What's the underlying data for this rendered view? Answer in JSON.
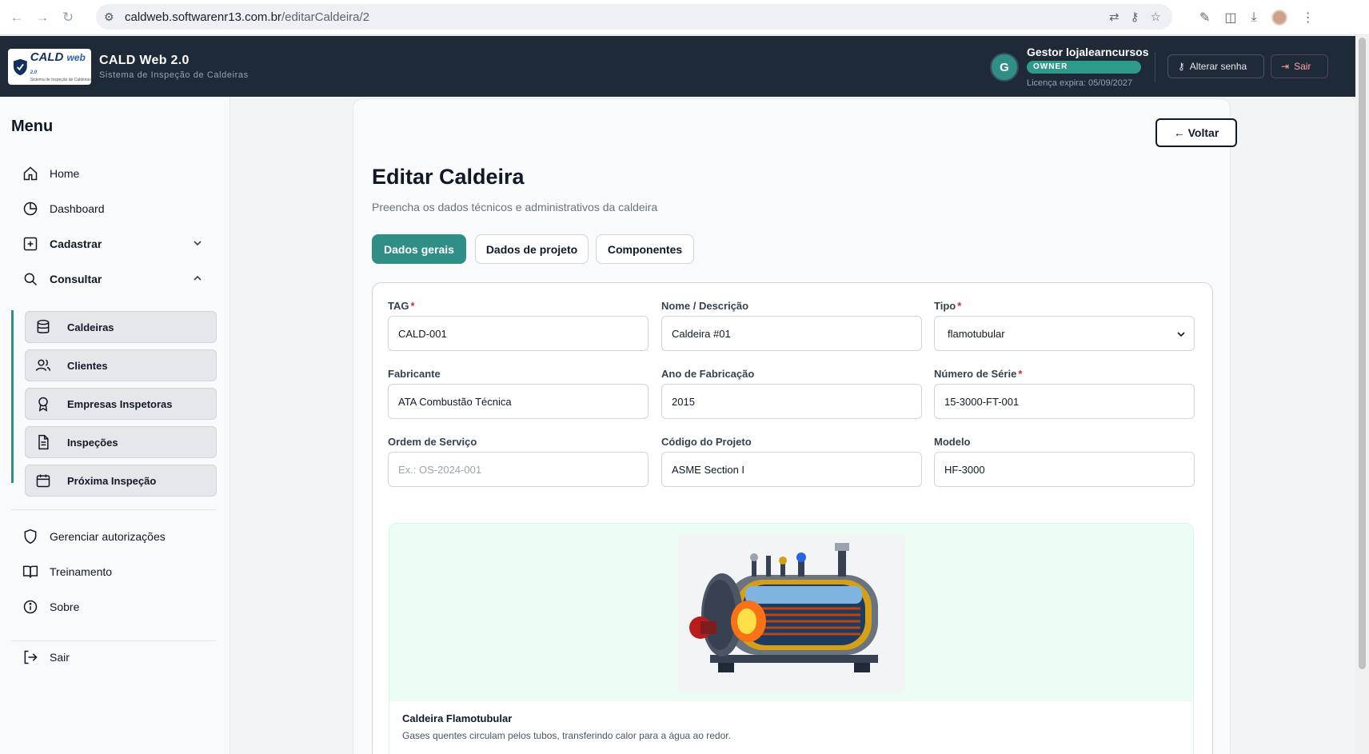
{
  "browser": {
    "url_domain": "caldweb.softwarenr13.com.br",
    "url_path": "/editarCaldeira/2"
  },
  "header": {
    "app_title": "CALD Web 2.0",
    "app_subtitle": "Sistema de Inspeção de Caldeiras",
    "logo_text": "CALD",
    "logo_web": "web",
    "logo_version": "2.0",
    "logo_tagline": "Sistema de Inspeção de Caldeiras",
    "user_initial": "G",
    "user_name": "Gestor lojalearncursos",
    "user_role": "OWNER",
    "license": "Licença expira: 05/09/2027",
    "change_password_label": "Alterar senha",
    "logout_label": "Sair"
  },
  "sidebar": {
    "title": "Menu",
    "items": [
      {
        "label": "Home",
        "icon": "home-icon"
      },
      {
        "label": "Dashboard",
        "icon": "pie-chart-icon"
      },
      {
        "label": "Cadastrar",
        "icon": "plus-square-icon"
      },
      {
        "label": "Consultar",
        "icon": "search-icon"
      }
    ],
    "sub_items": [
      {
        "label": "Caldeiras",
        "icon": "database-icon"
      },
      {
        "label": "Clientes",
        "icon": "users-icon"
      },
      {
        "label": "Empresas Inspetoras",
        "icon": "award-icon"
      },
      {
        "label": "Inspeções",
        "icon": "file-text-icon"
      },
      {
        "label": "Próxima Inspeção",
        "icon": "calendar-icon"
      }
    ],
    "bottom_items": [
      {
        "label": "Gerenciar autorizações",
        "icon": "shield-icon"
      },
      {
        "label": "Treinamento",
        "icon": "book-icon"
      },
      {
        "label": "Sobre",
        "icon": "info-icon"
      }
    ],
    "logout_label": "Sair"
  },
  "main": {
    "back_label": "← Voltar",
    "title": "Editar Caldeira",
    "subtitle": "Preencha os dados técnicos e administrativos da caldeira",
    "tabs": [
      {
        "label": "Dados gerais",
        "active": true
      },
      {
        "label": "Dados de projeto",
        "active": false
      },
      {
        "label": "Componentes",
        "active": false
      }
    ],
    "fields": {
      "tag": {
        "label": "TAG",
        "required": "*",
        "value": "CALD-001"
      },
      "descricao": {
        "label": "Nome / Descrição",
        "value": "Caldeira #01"
      },
      "tipo": {
        "label": "Tipo",
        "required": "*",
        "value": "flamotubular"
      },
      "fabricante": {
        "label": "Fabricante",
        "value": "ATA Combustão Técnica"
      },
      "ano": {
        "label": "Ano de Fabricação",
        "value": "2015"
      },
      "serie": {
        "label": "Número de Série",
        "required": "*",
        "value": "15-3000-FT-001"
      },
      "ordem": {
        "label": "Ordem de Serviço",
        "placeholder": "Ex.: OS-2024-001",
        "value": ""
      },
      "codigo": {
        "label": "Código do Projeto",
        "value": "ASME Section I"
      },
      "modelo": {
        "label": "Modelo",
        "value": "HF-3000"
      }
    },
    "boiler": {
      "name": "Caldeira Flamotubular",
      "description": "Gases quentes circulam pelos tubos, transferindo calor para a água ao redor."
    }
  },
  "colors": {
    "accent": "#2f8f86",
    "header_bg": "#1e2a38",
    "required": "#dc2626"
  }
}
